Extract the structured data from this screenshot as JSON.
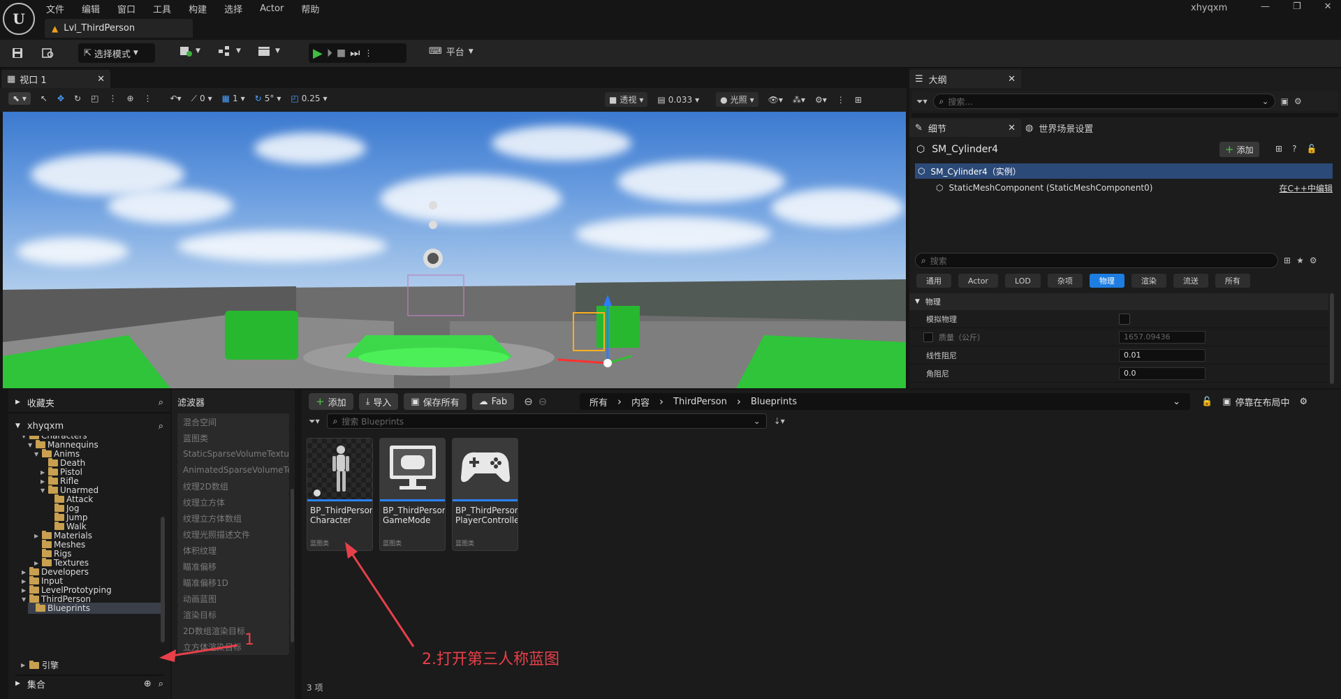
{
  "menu": [
    "文件",
    "编辑",
    "窗口",
    "工具",
    "构建",
    "选择",
    "Actor",
    "帮助"
  ],
  "level_tab": "Lvl_ThirdPerson",
  "username": "xhyqxm",
  "toolbar": {
    "mode": "选择模式",
    "platform": "平台"
  },
  "viewport": {
    "tab": "视口 1",
    "snap_angle_count": "0",
    "grid_count": "1",
    "rotate_snap": "5°",
    "scale_snap": "0.25",
    "view_mode": "透视",
    "camera_speed": "0.033",
    "lighting": "光照"
  },
  "outliner": {
    "title": "大纲",
    "search_placeholder": "搜索..."
  },
  "details": {
    "tab": "细节",
    "world_settings_tab": "世界场景设置",
    "actor_name": "SM_Cylinder4",
    "add_label": "添加",
    "instance_row": "SM_Cylinder4（实例）",
    "component_row": "StaticMeshComponent (StaticMeshComponent0)",
    "edit_cpp": "在C++中编辑",
    "search_placeholder": "搜索",
    "category_tabs": [
      "通用",
      "Actor",
      "LOD",
      "杂项",
      "物理",
      "渲染",
      "流送",
      "所有"
    ],
    "active_category": "物理",
    "section": "物理",
    "props": [
      {
        "label": "模拟物理",
        "value": ""
      },
      {
        "label": "质量（公斤）",
        "value": "1657.09436"
      },
      {
        "label": "线性阻尼",
        "value": "0.01"
      },
      {
        "label": "角阻尼",
        "value": "0.0"
      }
    ]
  },
  "content_browser": {
    "favorites": "收藏夹",
    "root": "xhyqxm",
    "collections": "集合",
    "engine": "引擎",
    "tree": [
      {
        "label": "Characters",
        "depth": 1,
        "open": true
      },
      {
        "label": "Mannequins",
        "depth": 2,
        "open": true
      },
      {
        "label": "Anims",
        "depth": 3,
        "open": true
      },
      {
        "label": "Death",
        "depth": 4,
        "open": false,
        "leaf": true
      },
      {
        "label": "Pistol",
        "depth": 4,
        "open": false
      },
      {
        "label": "Rifle",
        "depth": 4,
        "open": false
      },
      {
        "label": "Unarmed",
        "depth": 4,
        "open": true
      },
      {
        "label": "Attack",
        "depth": 5,
        "leaf": true
      },
      {
        "label": "Jog",
        "depth": 5,
        "leaf": true
      },
      {
        "label": "Jump",
        "depth": 5,
        "leaf": true
      },
      {
        "label": "Walk",
        "depth": 5,
        "leaf": true
      },
      {
        "label": "Materials",
        "depth": 3,
        "open": false
      },
      {
        "label": "Meshes",
        "depth": 3,
        "leaf": true
      },
      {
        "label": "Rigs",
        "depth": 3,
        "leaf": true
      },
      {
        "label": "Textures",
        "depth": 3,
        "open": false
      },
      {
        "label": "Developers",
        "depth": 1,
        "open": false
      },
      {
        "label": "Input",
        "depth": 1,
        "open": false
      },
      {
        "label": "LevelPrototyping",
        "depth": 1,
        "open": false
      },
      {
        "label": "ThirdPerson",
        "depth": 1,
        "open": true
      },
      {
        "label": "Blueprints",
        "depth": 2,
        "leaf": true,
        "selected": true
      }
    ],
    "filters_title": "滤波器",
    "filters": [
      "混合空间",
      "蓝图类",
      "StaticSparseVolumeTexture",
      "AnimatedSparseVolumeTexture",
      "纹理2D数组",
      "纹理立方体",
      "纹理立方体数组",
      "纹理光照描述文件",
      "体积纹理",
      "瞄准偏移",
      "瞄准偏移1D",
      "动画蓝图",
      "渲染目标",
      "2D数组渲染目标",
      "立方体渲染目标"
    ],
    "buttons": {
      "add": "添加",
      "import": "导入",
      "save_all": "保存所有",
      "fab": "Fab",
      "dock": "停靠在布局中"
    },
    "path": [
      "所有",
      "内容",
      "ThirdPerson",
      "Blueprints"
    ],
    "search_placeholder": "搜索 Blueprints",
    "assets": [
      {
        "line1": "BP_ThirdPerson",
        "line2": "Character",
        "type": "蓝图类"
      },
      {
        "line1": "BP_ThirdPerson",
        "line2": "GameMode",
        "type": "蓝图类"
      },
      {
        "line1": "BP_ThirdPerson",
        "line2": "PlayerController",
        "type": "蓝图类"
      }
    ],
    "count": "3 项"
  },
  "annotations": {
    "step1": "1",
    "step2": "2.打开第三人称蓝图",
    "color": "#e8404a"
  }
}
